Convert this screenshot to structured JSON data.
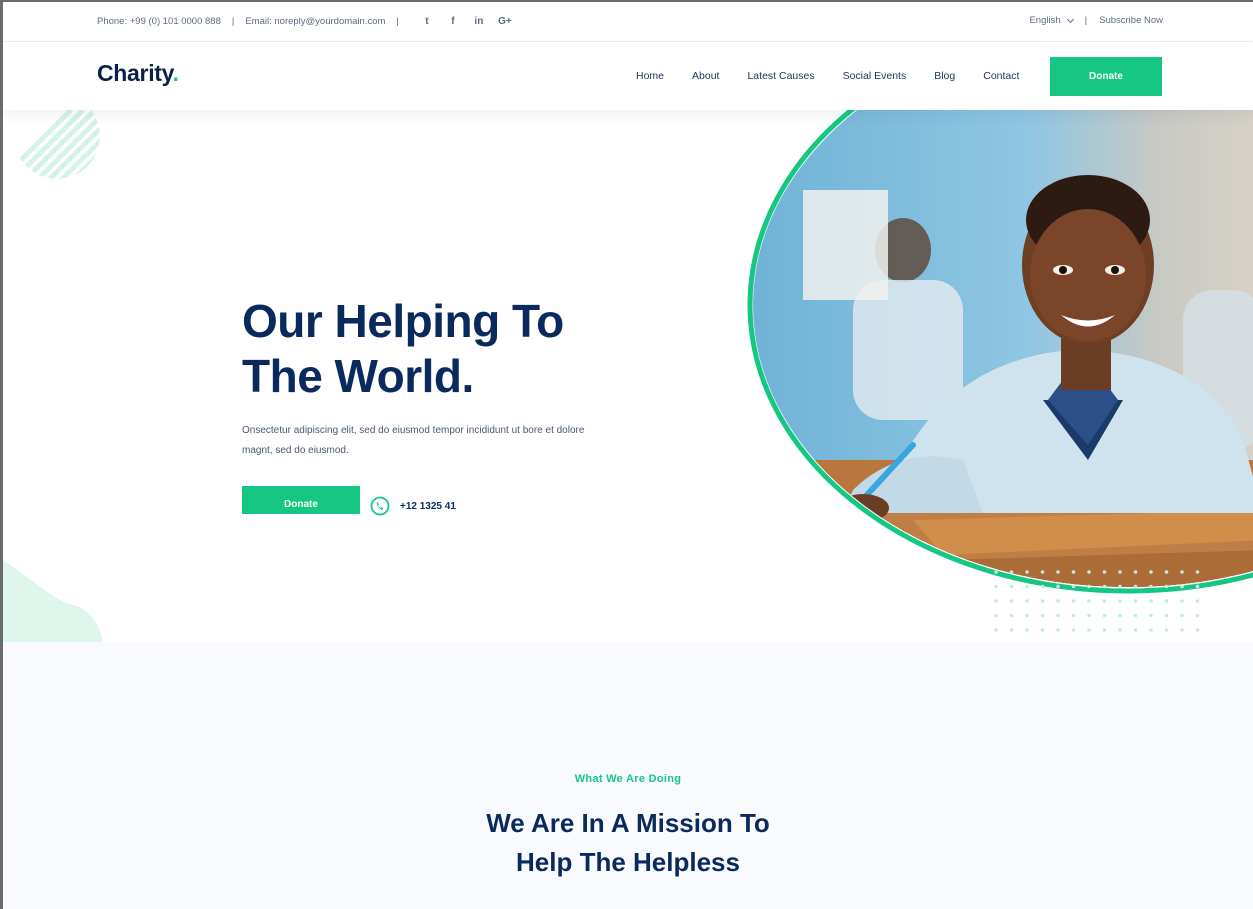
{
  "topbar": {
    "phone": "Phone: +99 (0) 101 0000 888",
    "email": "Email: noreply@yourdomain.com",
    "separator": "|",
    "social": [
      {
        "icon": "twitter-icon",
        "glyph": "t"
      },
      {
        "icon": "facebook-icon",
        "glyph": "f"
      },
      {
        "icon": "linkedin-icon",
        "glyph": "in"
      },
      {
        "icon": "google-plus-icon",
        "glyph": "G+"
      }
    ],
    "language": "English",
    "subscribe": "Subscribe Now"
  },
  "header": {
    "logo_text": "Charity",
    "logo_dot": ".",
    "nav": [
      "Home",
      "About",
      "Latest Causes",
      "Social Events",
      "Blog",
      "Contact"
    ],
    "donate_label": "Donate"
  },
  "hero": {
    "title_line1": "Our Helping To",
    "title_line2": "The World.",
    "description_line1": "Onsectetur adipiscing elit, sed do eiusmod tempor incididunt ut bore et dolore",
    "description_line2": "magnt, sed do eiusmod.",
    "donate_label": "Donate",
    "phone": "+12 1325 41"
  },
  "section2": {
    "kicker": "What We Are Doing",
    "title_line1": "We Are In A Mission To",
    "title_line2": "Help The Helpless"
  },
  "colors": {
    "accent": "#16c784",
    "heading": "#0a2a5e",
    "text": "#4a5775"
  }
}
